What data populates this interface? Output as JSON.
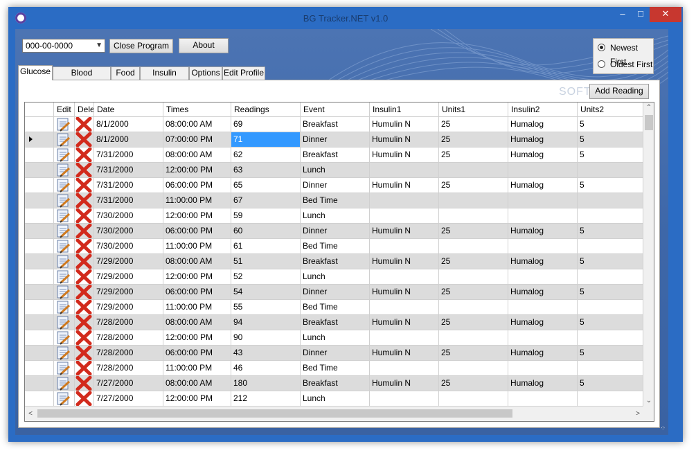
{
  "window": {
    "title": "BG Tracker.NET v1.0"
  },
  "toolbar": {
    "combo_value": "000-00-0000",
    "close_label": "Close Program",
    "about_label": "About"
  },
  "sort": {
    "newest": "Newest First",
    "oldest": "Oldest First",
    "selected": "newest"
  },
  "tabs": [
    "Glucose",
    "Blood Pressure",
    "Food",
    "Insulin Pump",
    "Options",
    "Edit Profile"
  ],
  "add_reading_label": "Add Reading",
  "watermark": "SOFT",
  "columns": [
    "Edit",
    "Dele",
    "Date",
    "Times",
    "Readings",
    "Event",
    "Insulin1",
    "Units1",
    "Insulin2",
    "Units2"
  ],
  "rows": [
    {
      "date": "8/1/2000",
      "time": "08:00:00 AM",
      "reading": "69",
      "event": "Breakfast",
      "ins1": "Humulin N",
      "u1": "25",
      "ins2": "Humalog",
      "u2": "5"
    },
    {
      "date": "8/1/2000",
      "time": "07:00:00 PM",
      "reading": "71",
      "event": "Dinner",
      "ins1": "Humulin N",
      "u1": "25",
      "ins2": "Humalog",
      "u2": "5",
      "current": true
    },
    {
      "date": "7/31/2000",
      "time": "08:00:00 AM",
      "reading": "62",
      "event": "Breakfast",
      "ins1": "Humulin N",
      "u1": "25",
      "ins2": "Humalog",
      "u2": "5"
    },
    {
      "date": "7/31/2000",
      "time": "12:00:00 PM",
      "reading": "63",
      "event": "Lunch",
      "ins1": "",
      "u1": "",
      "ins2": "",
      "u2": ""
    },
    {
      "date": "7/31/2000",
      "time": "06:00:00 PM",
      "reading": "65",
      "event": "Dinner",
      "ins1": "Humulin N",
      "u1": "25",
      "ins2": "Humalog",
      "u2": "5"
    },
    {
      "date": "7/31/2000",
      "time": "11:00:00 PM",
      "reading": "67",
      "event": "Bed Time",
      "ins1": "",
      "u1": "",
      "ins2": "",
      "u2": ""
    },
    {
      "date": "7/30/2000",
      "time": "12:00:00 PM",
      "reading": "59",
      "event": "Lunch",
      "ins1": "",
      "u1": "",
      "ins2": "",
      "u2": ""
    },
    {
      "date": "7/30/2000",
      "time": "06:00:00 PM",
      "reading": "60",
      "event": "Dinner",
      "ins1": "Humulin N",
      "u1": "25",
      "ins2": "Humalog",
      "u2": "5"
    },
    {
      "date": "7/30/2000",
      "time": "11:00:00 PM",
      "reading": "61",
      "event": "Bed Time",
      "ins1": "",
      "u1": "",
      "ins2": "",
      "u2": ""
    },
    {
      "date": "7/29/2000",
      "time": "08:00:00 AM",
      "reading": "51",
      "event": "Breakfast",
      "ins1": "Humulin N",
      "u1": "25",
      "ins2": "Humalog",
      "u2": "5"
    },
    {
      "date": "7/29/2000",
      "time": "12:00:00 PM",
      "reading": "52",
      "event": "Lunch",
      "ins1": "",
      "u1": "",
      "ins2": "",
      "u2": ""
    },
    {
      "date": "7/29/2000",
      "time": "06:00:00 PM",
      "reading": "54",
      "event": "Dinner",
      "ins1": "Humulin N",
      "u1": "25",
      "ins2": "Humalog",
      "u2": "5"
    },
    {
      "date": "7/29/2000",
      "time": "11:00:00 PM",
      "reading": "55",
      "event": "Bed Time",
      "ins1": "",
      "u1": "",
      "ins2": "",
      "u2": ""
    },
    {
      "date": "7/28/2000",
      "time": "08:00:00 AM",
      "reading": "94",
      "event": "Breakfast",
      "ins1": "Humulin N",
      "u1": "25",
      "ins2": "Humalog",
      "u2": "5"
    },
    {
      "date": "7/28/2000",
      "time": "12:00:00 PM",
      "reading": "90",
      "event": "Lunch",
      "ins1": "",
      "u1": "",
      "ins2": "",
      "u2": ""
    },
    {
      "date": "7/28/2000",
      "time": "06:00:00 PM",
      "reading": "43",
      "event": "Dinner",
      "ins1": "Humulin N",
      "u1": "25",
      "ins2": "Humalog",
      "u2": "5"
    },
    {
      "date": "7/28/2000",
      "time": "11:00:00 PM",
      "reading": "46",
      "event": "Bed Time",
      "ins1": "",
      "u1": "",
      "ins2": "",
      "u2": ""
    },
    {
      "date": "7/27/2000",
      "time": "08:00:00 AM",
      "reading": "180",
      "event": "Breakfast",
      "ins1": "Humulin N",
      "u1": "25",
      "ins2": "Humalog",
      "u2": "5"
    },
    {
      "date": "7/27/2000",
      "time": "12:00:00 PM",
      "reading": "212",
      "event": "Lunch",
      "ins1": "",
      "u1": "",
      "ins2": "",
      "u2": ""
    }
  ],
  "colors": {
    "title_bar": "#2b6cc4",
    "close_button": "#c7372f",
    "selection": "#3399ff",
    "alt_row": "#dcdcdc"
  },
  "icons": {
    "edit": "edit-notepad-icon",
    "delete": "delete-x-icon",
    "app": "app-icon"
  }
}
